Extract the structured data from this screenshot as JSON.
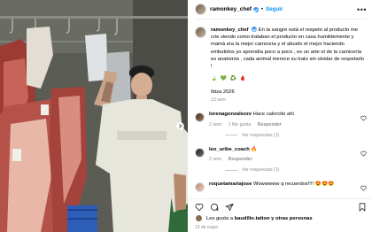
{
  "post": {
    "author": "ramonkey_chef",
    "separator": "•",
    "follow_label": "Seguir",
    "more_label": "•••",
    "caption_author": "ramonkey_chef",
    "caption_text": "En la sangre está el respeto al producto me crie viendo como trataban el producto en casa humildemente y mamá era la mejor carnicera y el abuelo el mejor haciendo embutidos yo aprendía poco a poco , es un arte el de la carnicería es anatomía , cada animal merece su trato sin olvidar de respetarlo !",
    "caption_emojis": "🍃 💚 ♻️ 🩸",
    "location": "Ibiza 2026",
    "caption_time": "13 sem"
  },
  "comments": [
    {
      "user": "lorenagonzalezzv",
      "text": "Hace calorcito ahí",
      "time": "2 sem",
      "likes": "1 Me gusta",
      "reply": "Responder",
      "replies": "Ver respuestas (1)"
    },
    {
      "user": "leo_uribe_coach",
      "text": "🔥",
      "time": "2 sem",
      "likes": "",
      "reply": "Responder",
      "replies": "Ver respuestas (1)"
    },
    {
      "user": "roquetamariajose",
      "text": "Wowwwww q recuerdos!!!! 😍😍😍",
      "time": "",
      "likes": "",
      "reply": "",
      "replies": ""
    }
  ],
  "footer": {
    "likes_prefix": "Les gusta a",
    "likes_user": "baudilio.tattoo",
    "likes_suffix": "y otras personas",
    "date": "13 de mayo"
  },
  "colors": {
    "accent": "#0095f6",
    "verified": "#3897f0",
    "muted": "#8e8e8e"
  },
  "icons": [
    "heart-icon",
    "comment-icon",
    "share-icon",
    "bookmark-icon",
    "verified-badge-icon",
    "more-options-icon",
    "carousel-next-icon"
  ]
}
